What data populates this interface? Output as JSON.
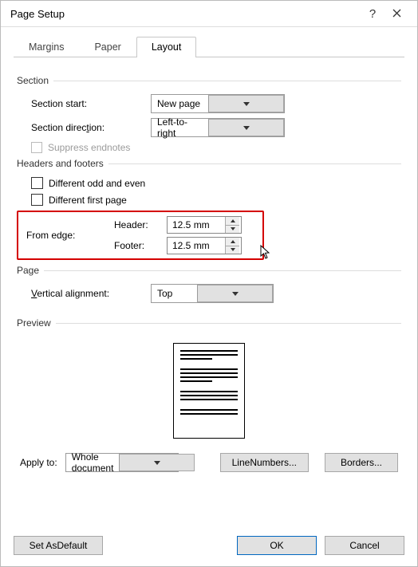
{
  "window": {
    "title": "Page Setup"
  },
  "tabs": {
    "margins": "Margins",
    "paper": "Paper",
    "layout": "Layout"
  },
  "section": {
    "heading": "Section",
    "start_label": "Section start:",
    "start_value": "New page",
    "direction_label": "Section direc",
    "direction_u": "t",
    "direction_label2": "ion:",
    "direction_value": "Left-to-right",
    "suppress": "Suppress endnotes"
  },
  "hf": {
    "heading": "Headers and footers",
    "diff_odd_even": "Different odd and even",
    "diff_first": "Different first page",
    "from_edge": "From edge:",
    "header_label_pre": "",
    "header_u": "H",
    "header_label_post": "eader:",
    "footer_label_pre": "",
    "footer_u": "F",
    "footer_label_post": "ooter:",
    "header_value": "12.5 mm",
    "footer_value": "12.5 mm"
  },
  "page": {
    "heading": "Page",
    "valign_pre": "",
    "valign_u": "V",
    "valign_post": "ertical alignment:",
    "valign_value": "Top"
  },
  "preview": {
    "heading": "Preview"
  },
  "apply": {
    "label": "Apply to:",
    "value": "Whole document",
    "line_numbers_pre": "Line ",
    "line_numbers_u": "N",
    "line_numbers_post": "umbers...",
    "borders_pre": "",
    "borders_u": "B",
    "borders_post": "orders..."
  },
  "buttons": {
    "set_default_pre": "Set As ",
    "set_default_u": "D",
    "set_default_post": "efault",
    "ok": "OK",
    "cancel": "Cancel"
  }
}
